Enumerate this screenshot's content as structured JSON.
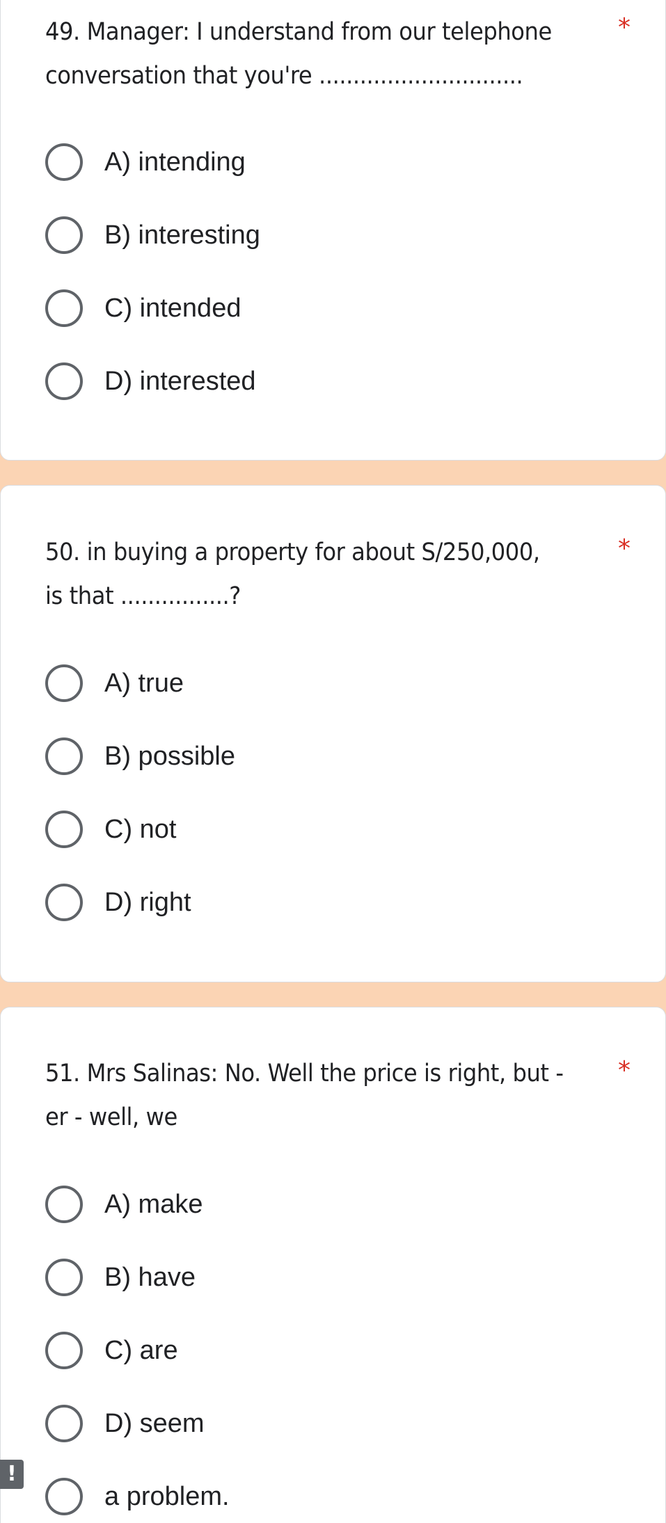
{
  "colors": {
    "background": "#fbd4b4",
    "card": "#ffffff",
    "required_asterisk": "#d93025",
    "radio_border": "#5f6368"
  },
  "questions": [
    {
      "title": "49. Manager: I understand from our telephone conversation that you're ..............................",
      "required_mark": "*",
      "options": [
        "A) intending",
        "B) interesting",
        "C) intended",
        "D) interested"
      ]
    },
    {
      "title": "50. in buying a property for about S/250,000, is that ................?",
      "required_mark": "*",
      "options": [
        "A) true",
        "B) possible",
        "C) not",
        "D) right"
      ]
    },
    {
      "title": "51. Mrs Salinas: No. Well the price is right, but - er - well, we",
      "required_mark": "*",
      "options": [
        "A) make",
        "B) have",
        "C) are",
        "D) seem",
        "a problem."
      ]
    }
  ],
  "alert_badge": {
    "glyph": "!",
    "icon": "exclamation-icon"
  }
}
